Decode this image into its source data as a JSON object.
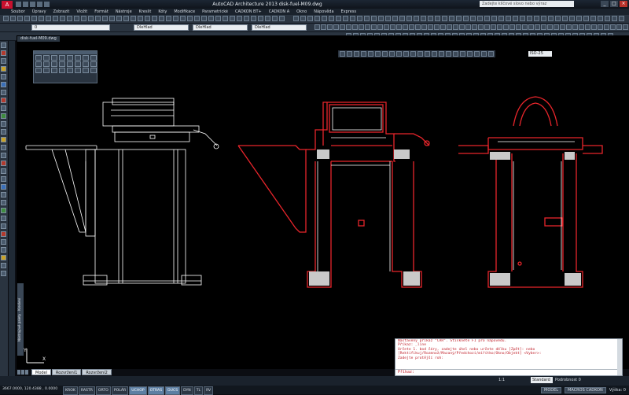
{
  "titlebar": {
    "app_label": "A",
    "title": "AutoCAD Architecture 2013   disk-fuel-M09.dwg",
    "search_placeholder": "Zadejte klíčové slovo nebo výraz"
  },
  "menu": [
    "Soubor",
    "Úpravy",
    "Zobrazit",
    "Vložit",
    "Formát",
    "Nástroje",
    "Kreslit",
    "Kóty",
    "Modifikace",
    "Parametrické",
    "CADKON BT+",
    "CADKON A",
    "Okno",
    "Nápověda",
    "Express"
  ],
  "toolbars": {
    "layer_combo": "0",
    "linetype_combo": "DleHlad",
    "lineweight_combo": "DleHlad",
    "color_combo": "DleHlad",
    "iso_combo": "ISO-25"
  },
  "document_tab": "disk-fuel-M09.dwg",
  "palette_label": "Nástrojové palety - Kreslení",
  "layout_tabs": [
    "Model",
    "Rozvržení1",
    "Rozvržení2"
  ],
  "command_history": [
    "Nastavený příkaz \"ČÁR\". Stiskněte F1 pro nápovědu.",
    "Příkaz: _line",
    "Určete 1. bod čáry, zadejte úhel nebo určete délku [Zpět]: nebo",
    "[Rektifikuj/Rozmnož/Mazaný/Předchozí/mířítko/Okno/Objekt] <Vyber>:",
    "Zadejte protější roh:"
  ],
  "command_prompt": "Příkaz:",
  "statusbar": {
    "coordinates": "3667.0000, 120.4388 , 0.0000",
    "toggles": [
      {
        "label": "KROK",
        "on": false
      },
      {
        "label": "RASTR",
        "on": false
      },
      {
        "label": "ORTO",
        "on": false
      },
      {
        "label": "POLÁR",
        "on": false
      },
      {
        "label": "UCHOP",
        "on": true
      },
      {
        "label": "OTRAS",
        "on": true
      },
      {
        "label": "DUCS",
        "on": true
      },
      {
        "label": "DYN",
        "on": false
      },
      {
        "label": "TL",
        "on": false
      },
      {
        "label": "RV",
        "on": false
      }
    ],
    "model": "MODEL",
    "scale": "1:1",
    "standard": "Standard",
    "detail_label": "Podrobnost",
    "detail_value": "0",
    "vendor": "MACROS CADKON",
    "status_right": "Výška: 0"
  },
  "colors": {
    "outline_red": "#e8252b",
    "line_white": "#ffffff",
    "background": "#000000"
  }
}
